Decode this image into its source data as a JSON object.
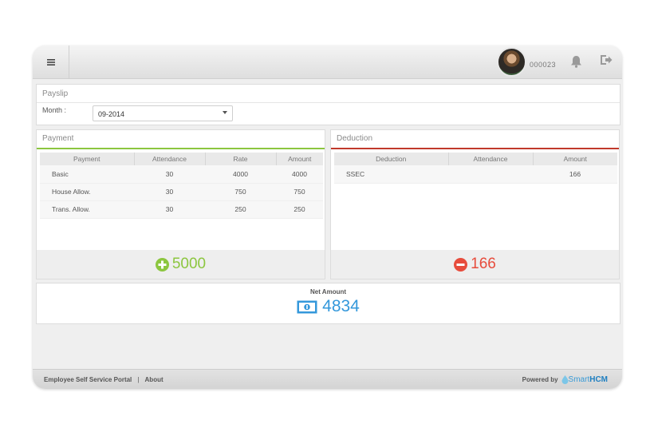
{
  "header": {
    "user_id": "000023"
  },
  "payslip": {
    "title": "Payslip",
    "month_label": "Month :",
    "month_value": "09-2014"
  },
  "payment": {
    "title": "Payment",
    "columns": [
      "Payment",
      "Attendance",
      "Rate",
      "Amount"
    ],
    "rows": [
      [
        "Basic",
        "30",
        "4000",
        "4000"
      ],
      [
        "House Allow.",
        "30",
        "750",
        "750"
      ],
      [
        "Trans. Allow.",
        "30",
        "250",
        "250"
      ]
    ],
    "total": "5000"
  },
  "deduction": {
    "title": "Deduction",
    "columns": [
      "Deduction",
      "Attendance",
      "Amount"
    ],
    "rows": [
      [
        "SSEC",
        "",
        "166"
      ]
    ],
    "total": "166"
  },
  "net": {
    "label": "Net Amount",
    "value": "4834"
  },
  "footer": {
    "portal": "Employee Self Service Portal",
    "separator": "|",
    "about": "About",
    "powered_by": "Powered by",
    "brand_a": "Smart",
    "brand_b": "HCM"
  },
  "colors": {
    "payment_accent": "#8cc63f",
    "deduction_accent": "#c0392b",
    "net_accent": "#3498db"
  }
}
